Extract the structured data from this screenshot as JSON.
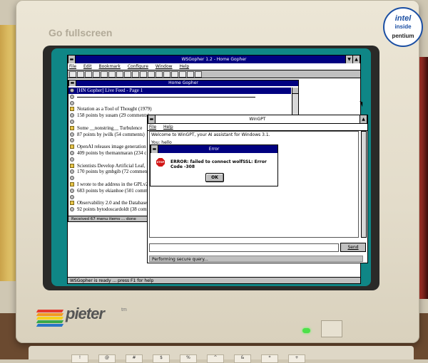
{
  "monitor": {
    "overlay_label": "Go fullscreen",
    "badge": {
      "line1": "intel",
      "line2": "inside",
      "line3": "pentium"
    },
    "brand": "pieter",
    "brand_tm": "tm",
    "brand_stripes": [
      "#e53b2e",
      "#f39a22",
      "#f5d21c",
      "#3aa949",
      "#2a75c7"
    ]
  },
  "gopher": {
    "title": "WSGopher 1.2 - Home Gopher",
    "menu": [
      "File",
      "Edit",
      "Bookmark",
      "Configure",
      "Window",
      "Help"
    ],
    "inner_title": "Home Gopher",
    "items": [
      {
        "icon": "info",
        "text": "[HN Gopher] Live Feed - Page 1",
        "selected": true
      },
      {
        "icon": "info",
        "text": "",
        "rule": true
      },
      {
        "icon": "info",
        "text": ""
      },
      {
        "icon": "dir",
        "text": "Notation as a Tool of Thought (1979)"
      },
      {
        "icon": "info",
        "text": "158 points by susam (29 comments)"
      },
      {
        "icon": "info",
        "text": ""
      },
      {
        "icon": "dir",
        "text": "Some __nonstring__ Turbulence"
      },
      {
        "icon": "info",
        "text": "87 points by jwilk (54 comments)"
      },
      {
        "icon": "info",
        "text": ""
      },
      {
        "icon": "dir",
        "text": "OpenAI releases image generation"
      },
      {
        "icon": "info",
        "text": "409 points by themanmaran (234 c"
      },
      {
        "icon": "info",
        "text": ""
      },
      {
        "icon": "dir",
        "text": "Scientists Develop Artificial Leaf,"
      },
      {
        "icon": "info",
        "text": "170 points by gmbgib (72 comment"
      },
      {
        "icon": "info",
        "text": ""
      },
      {
        "icon": "dir",
        "text": "I wrote to the address in the GPLv2"
      },
      {
        "icon": "info",
        "text": "683 points by ekianhoe (501 comm"
      },
      {
        "icon": "info",
        "text": ""
      },
      {
        "icon": "dir",
        "text": "Observability 2.0 and the Database"
      },
      {
        "icon": "info",
        "text": "92 points bytodoscardoldt (38 comm"
      }
    ],
    "inner_status": "Received 67 menu items ... done",
    "status": "WSGopher is ready ... press F1 for help"
  },
  "wingpt": {
    "title": "WinGPT",
    "menu": [
      "File",
      "Help"
    ],
    "messages": [
      "Welcome to WinGPT, your AI assistant for Windows 3.1.",
      "You: hello"
    ],
    "send_label": "Send",
    "status": "Performing secure query..."
  },
  "error": {
    "title": "Error",
    "icon_label": "STOP",
    "message": "ERROR: failed to connect wolfSSL: Error Code -308",
    "ok_label": "OK"
  },
  "keyboard": {
    "keys": [
      "!",
      "@",
      "#",
      "$",
      "%",
      "^",
      "&",
      "*",
      "+"
    ]
  }
}
